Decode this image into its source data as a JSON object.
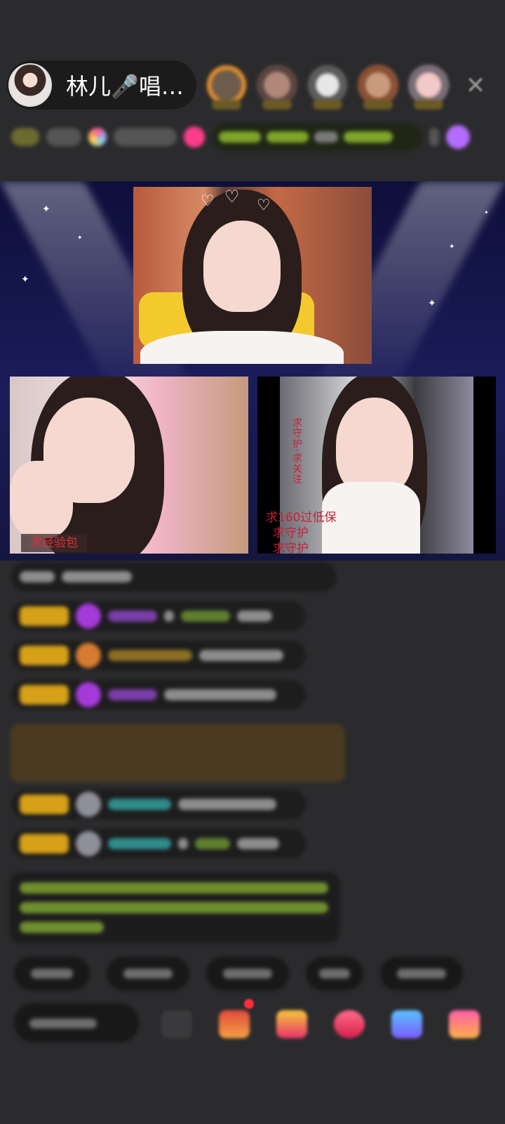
{
  "header": {
    "host_name": "林儿🎤唱…",
    "close_icon": "close-icon"
  },
  "audience": [
    "viewer-avatar-1",
    "viewer-avatar-2",
    "viewer-avatar-3",
    "viewer-avatar-4",
    "viewer-avatar-5"
  ],
  "stage": {
    "left_feed_sign": "求经验包",
    "right_feed_sign_lines": [
      "求160过低保",
      "求守护",
      "求守护"
    ]
  },
  "colors": {
    "background": "#2b2b2d",
    "stage_background": "#15163f",
    "sign_red": "#c8203a",
    "badge_gold": "#d6a018"
  }
}
